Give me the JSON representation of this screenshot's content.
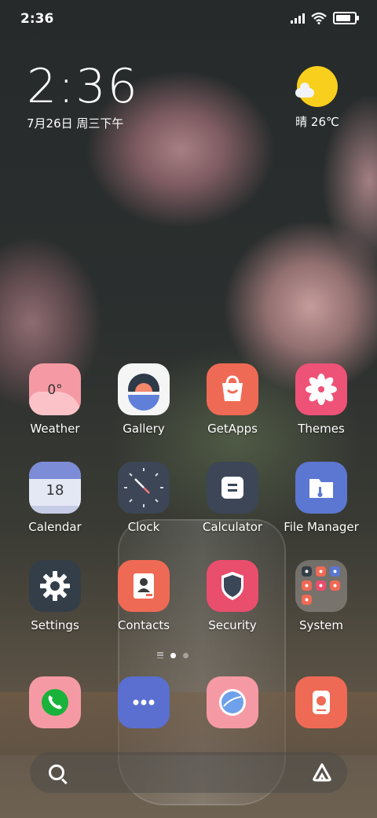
{
  "status_bar": {
    "time": "2:36",
    "battery_level_percent": 80
  },
  "clock_widget": {
    "time": "2:36",
    "date": "7月26日 周三下午"
  },
  "weather_widget": {
    "condition_temp": "晴 26℃",
    "icon": "sun-with-cloud-icon"
  },
  "apps_row1": [
    {
      "label": "Weather",
      "badge": "0°",
      "icon": "weather-icon"
    },
    {
      "label": "Gallery",
      "icon": "gallery-icon"
    },
    {
      "label": "GetApps",
      "icon": "shopping-bag-icon"
    },
    {
      "label": "Themes",
      "icon": "flower-icon"
    }
  ],
  "apps_row2": [
    {
      "label": "Calendar",
      "day": "18",
      "icon": "calendar-icon"
    },
    {
      "label": "Clock",
      "icon": "clock-icon"
    },
    {
      "label": "Calculator",
      "icon": "calculator-icon"
    },
    {
      "label": "File Manager",
      "icon": "folder-icon"
    }
  ],
  "apps_row3": [
    {
      "label": "Settings",
      "icon": "gear-icon"
    },
    {
      "label": "Contacts",
      "icon": "contacts-icon"
    },
    {
      "label": "Security",
      "icon": "shield-icon"
    },
    {
      "label": "System",
      "icon": "folder-grid-icon"
    }
  ],
  "dock": [
    {
      "name": "Phone",
      "icon": "phone-icon"
    },
    {
      "name": "Messaging",
      "icon": "chat-icon"
    },
    {
      "name": "Browser",
      "icon": "browser-icon"
    },
    {
      "name": "Camera",
      "icon": "camera-icon"
    }
  ],
  "page_indicator": {
    "pages": 2,
    "active": 1
  },
  "colors": {
    "weather": "#f59aa4",
    "gallery": "#f5f5f5",
    "getapps": "#ef6a55",
    "themes": "#ee5277",
    "calendar": "#7c8cd6",
    "clock": "#3c4656",
    "calculator": "#3c4656",
    "filemanager": "#5c77d1",
    "settings": "#343e48",
    "contacts": "#ef6a55",
    "security": "#ea4e6d",
    "phone": "#f59aa4",
    "messaging": "#5a6fd0",
    "browser": "#f59aa4",
    "camera": "#ef6a55",
    "sun": "#f8cf1c"
  }
}
